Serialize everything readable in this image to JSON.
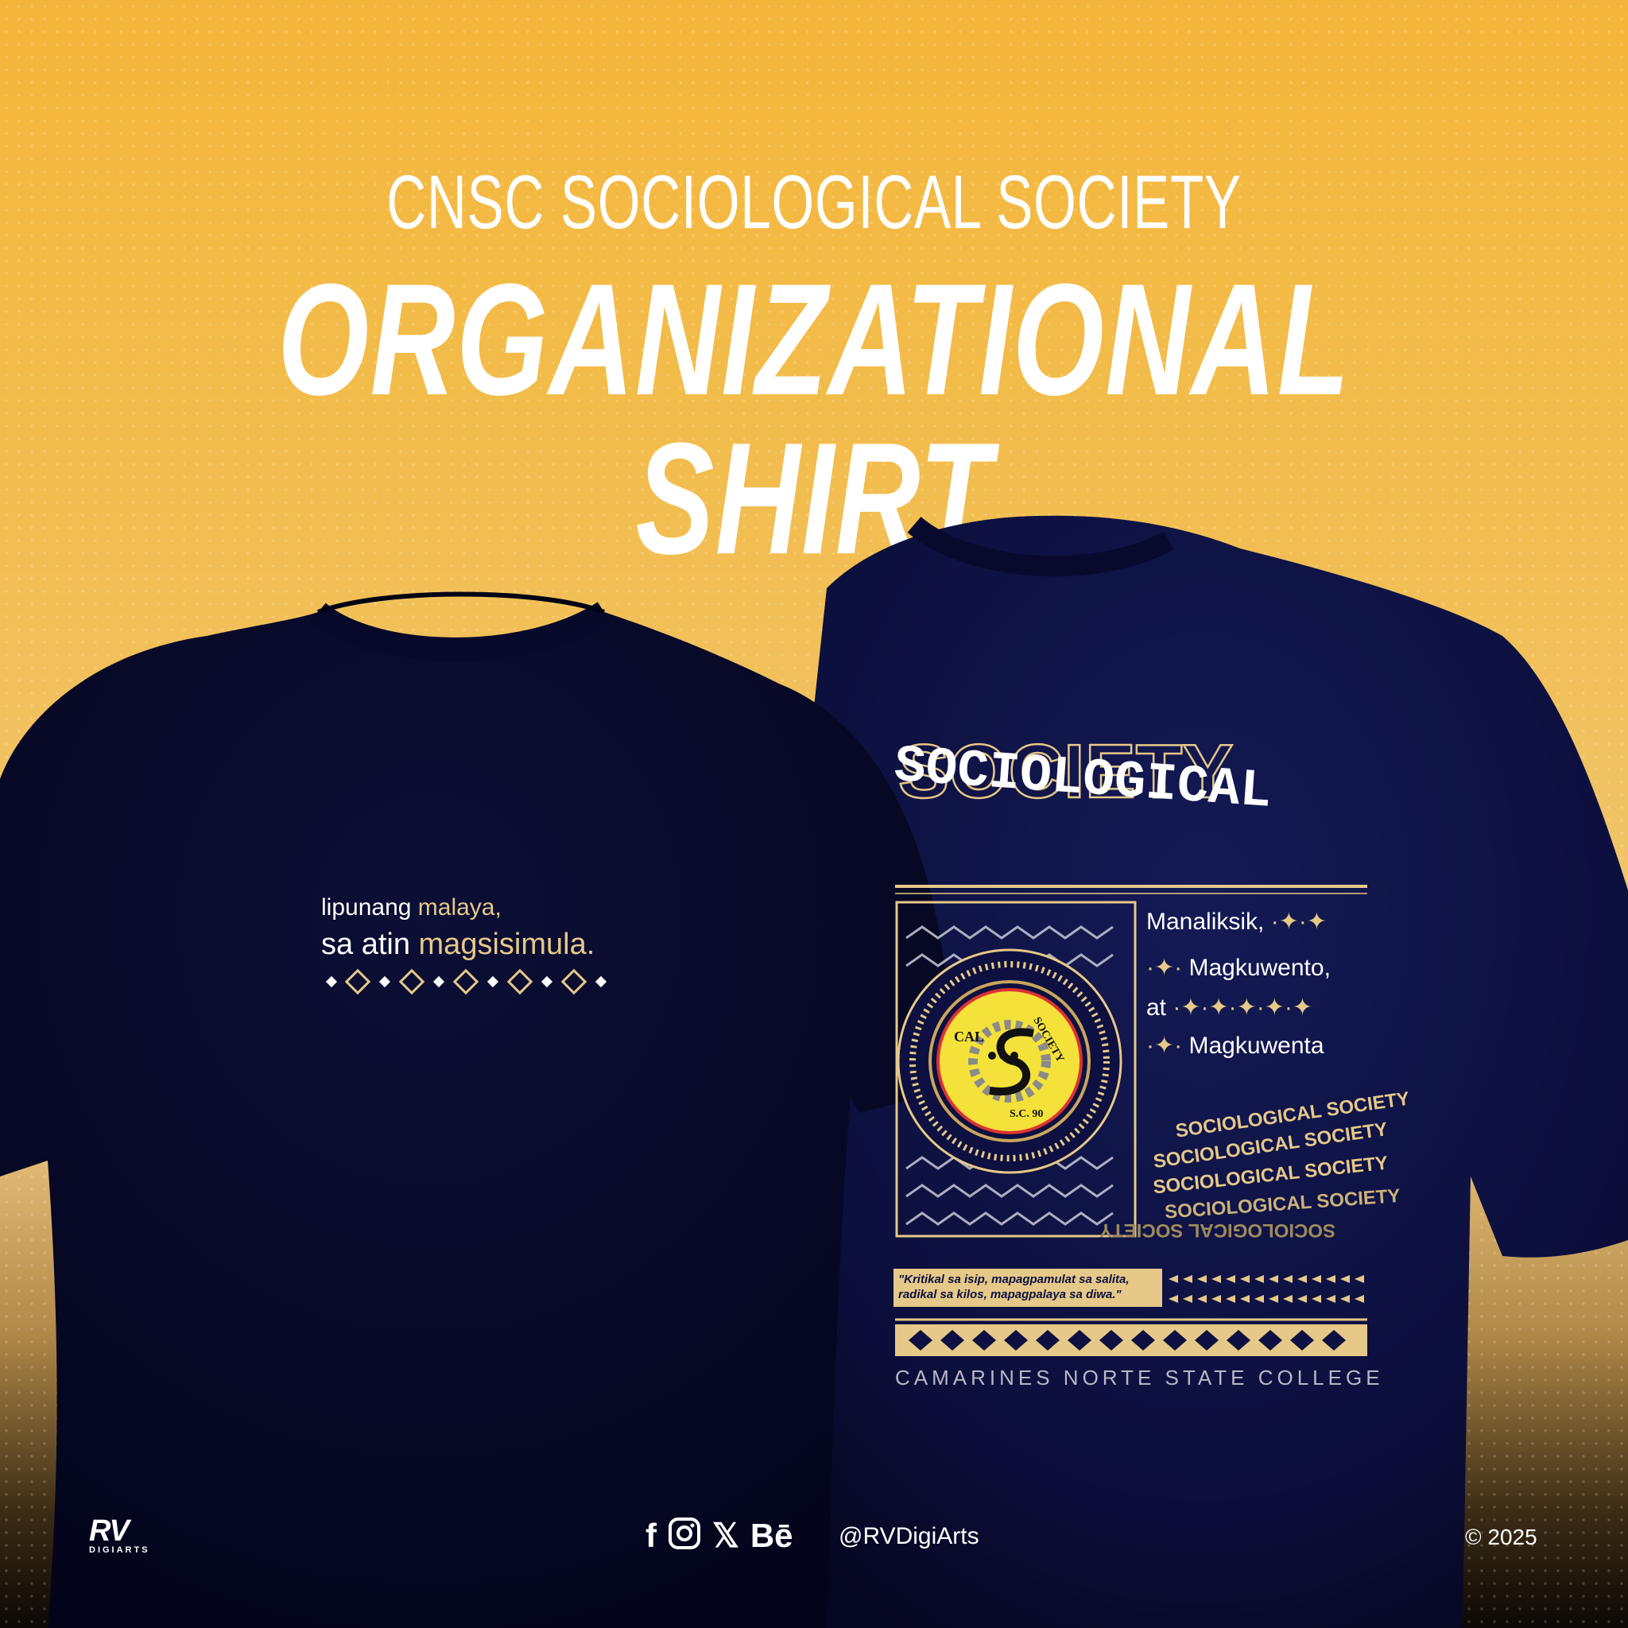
{
  "header": {
    "subtitle": "CNSC SOCIOLOGICAL SOCIETY",
    "title": "ORGANIZATIONAL SHIRT"
  },
  "front_print": {
    "line1_prefix": "lipunang ",
    "line1_highlight": "malaya,",
    "line2_prefix": "sa atin ",
    "line2_highlight": "magsisimula."
  },
  "back_print": {
    "heading_top": "SOCIOLOGICAL",
    "heading_bottom": "SOCIETY",
    "motto": {
      "line1": "Manaliksik,",
      "line2": "Magkuwento,",
      "line3": "at",
      "line4": "Magkuwenta"
    },
    "seal_text_left": "CAL",
    "seal_text_right": "SOCIETY",
    "seal_text_bottom": "S.C. 90",
    "swirl_text": "SOCIOLOGICAL SOCIETY",
    "quote": "\"Kritikal sa isip, mapagpamulat sa salita, radikal sa kilos, mapagpalaya sa diwa.\"",
    "college": "CAMARINES NORTE STATE COLLEGE"
  },
  "footer": {
    "logo": "RV",
    "logo_sub": "DIGIARTS",
    "social_icons": [
      "facebook-icon",
      "instagram-icon",
      "x-icon",
      "behance-icon"
    ],
    "handle": "@RVDigiArts",
    "copyright": "© 2025"
  },
  "colors": {
    "background": "#f4b63a",
    "shirt": "#0d1040",
    "accent_gold": "#e6c888",
    "text": "#ffffff"
  }
}
